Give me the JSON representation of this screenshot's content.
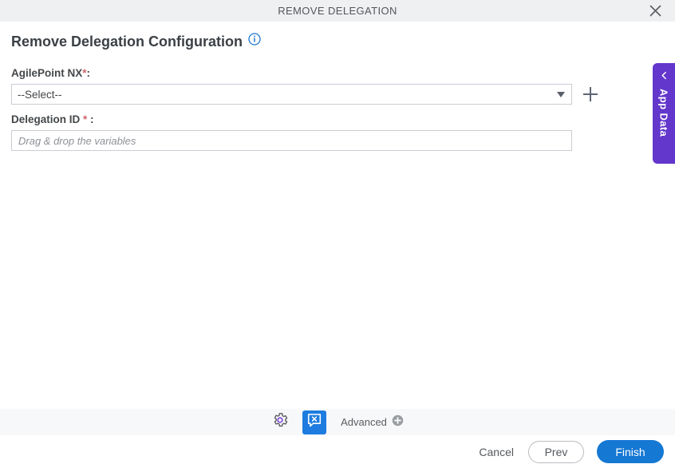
{
  "window": {
    "title": "REMOVE DELEGATION",
    "close_icon": "close-icon"
  },
  "page": {
    "heading": "Remove Delegation Configuration",
    "info_icon": "info-circle-icon"
  },
  "form": {
    "fields": [
      {
        "label": "AgilePoint NX",
        "required_marker": "*",
        "suffix": ":",
        "type": "select",
        "value": "--Select--",
        "caret_icon": "chevron-down-icon",
        "add_icon": "plus-icon"
      },
      {
        "label": "Delegation ID ",
        "required_marker": "*",
        "suffix": " :",
        "type": "text",
        "value": "",
        "placeholder": "Drag & drop the variables"
      }
    ]
  },
  "app_data_panel": {
    "label": "App Data",
    "collapse_icon": "chevron-left-icon",
    "color": "#6336cc"
  },
  "toolbar": {
    "settings_icon": "gear-icon",
    "validation_icon": "speech-bubble-x-icon",
    "advanced_label": "Advanced",
    "advanced_add_icon": "circle-plus-icon"
  },
  "footer": {
    "cancel_label": "Cancel",
    "prev_label": "Prev",
    "finish_label": "Finish",
    "primary_color": "#1578d3"
  }
}
